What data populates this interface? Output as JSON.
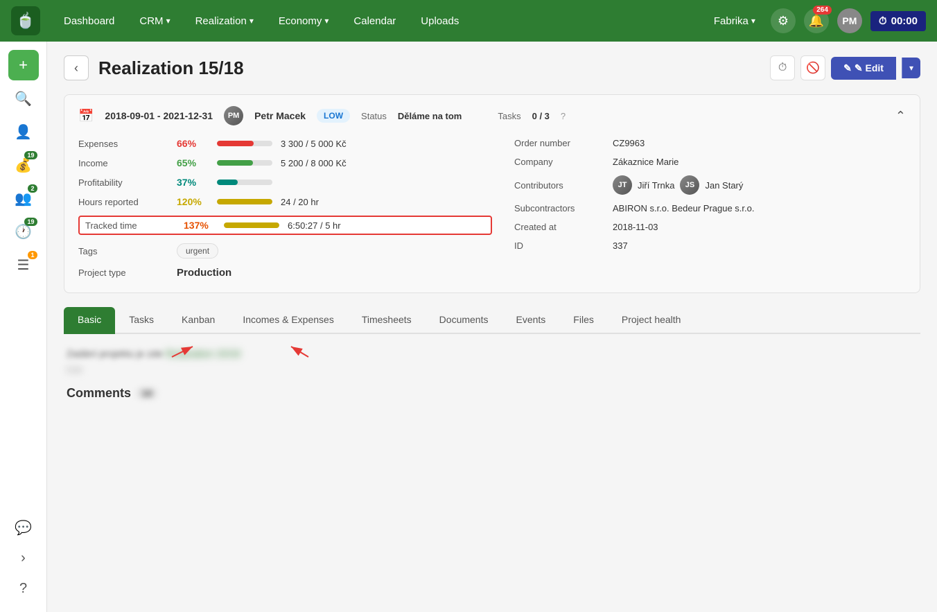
{
  "nav": {
    "logo_icon": "🍵",
    "items": [
      {
        "label": "Dashboard",
        "has_dropdown": false
      },
      {
        "label": "CRM",
        "has_dropdown": true
      },
      {
        "label": "Realization",
        "has_dropdown": true
      },
      {
        "label": "Economy",
        "has_dropdown": true
      },
      {
        "label": "Calendar",
        "has_dropdown": false
      },
      {
        "label": "Uploads",
        "has_dropdown": false
      }
    ],
    "company": "Fabrika",
    "bell_count": "264",
    "timer": "00:00"
  },
  "sidebar": {
    "items": [
      {
        "icon": "+",
        "badge": null,
        "label": "add"
      },
      {
        "icon": "🔍",
        "badge": null,
        "label": "search"
      },
      {
        "icon": "👤",
        "badge": null,
        "label": "user"
      },
      {
        "icon": "💰",
        "badge": "19",
        "badge_color": "green",
        "label": "finance"
      },
      {
        "icon": "👥",
        "badge": "2",
        "badge_color": "green",
        "label": "team"
      },
      {
        "icon": "🕐",
        "badge": "19",
        "badge_color": "green",
        "label": "time"
      },
      {
        "icon": "☰",
        "badge": "1",
        "badge_color": "orange",
        "label": "menu"
      }
    ],
    "bottom_items": [
      {
        "icon": "💬",
        "label": "chat"
      },
      {
        "icon": "›",
        "label": "expand"
      },
      {
        "icon": "?",
        "label": "help"
      }
    ]
  },
  "page": {
    "title": "Realization 15/18",
    "back_label": "‹",
    "edit_label": "✎ Edit"
  },
  "project": {
    "date_range": "2018-09-01 - 2021-12-31",
    "person_name": "Petr Macek",
    "priority": "LOW",
    "status_label": "Status",
    "status_value": "Děláme na tom",
    "tasks_label": "Tasks",
    "tasks_value": "0 / 3",
    "tasks_q": "?",
    "metrics": {
      "expenses_label": "Expenses",
      "expenses_pct": "66%",
      "expenses_bar_width": 66,
      "expenses_value": "3 300 / 5 000 Kč",
      "income_label": "Income",
      "income_pct": "65%",
      "income_bar_width": 65,
      "income_value": "5 200 / 8 000 Kč",
      "profitability_label": "Profitability",
      "profitability_pct": "37%",
      "profitability_bar_width": 37,
      "hours_label": "Hours reported",
      "hours_pct": "120%",
      "hours_bar_width": 100,
      "hours_value": "24 / 20 hr",
      "tracked_label": "Tracked time",
      "tracked_pct": "137%",
      "tracked_bar_width": 100,
      "tracked_value": "6:50:27 / 5 hr",
      "tags_label": "Tags",
      "tag_value": "urgent",
      "project_type_label": "Project type",
      "project_type_value": "Production"
    },
    "right_metrics": {
      "order_label": "Order number",
      "order_value": "CZ9963",
      "company_label": "Company",
      "company_value": "Zákaznice Marie",
      "contributors_label": "Contributors",
      "contributors": [
        "Jiří Trnka",
        "Jan Starý"
      ],
      "subcontractors_label": "Subcontractors",
      "subcontractors_value": "ABIRON s.r.o.   Bedeur Prague s.r.o.",
      "created_label": "Created at",
      "created_value": "2018-11-03",
      "id_label": "ID",
      "id_value": "337"
    }
  },
  "tabs": {
    "items": [
      {
        "label": "Basic",
        "active": true
      },
      {
        "label": "Tasks",
        "active": false
      },
      {
        "label": "Kanban",
        "active": false
      },
      {
        "label": "Incomes & Expenses",
        "active": false
      },
      {
        "label": "Timesheets",
        "active": false
      },
      {
        "label": "Documents",
        "active": false
      },
      {
        "label": "Events",
        "active": false
      },
      {
        "label": "Files",
        "active": false
      },
      {
        "label": "Project health",
        "active": false
      }
    ]
  },
  "content": {
    "blurred_line1": "Zadáni projektu je zde Realization 15/18",
    "blurred_line2": "Edit",
    "comments_title": "Comments",
    "comments_count": "10"
  }
}
